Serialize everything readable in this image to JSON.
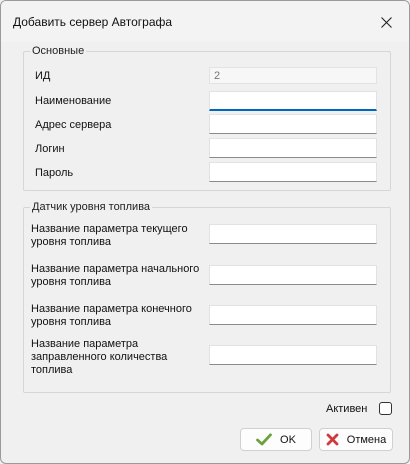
{
  "window": {
    "title": "Добавить сервер Автографа"
  },
  "main_group": {
    "legend": "Основные",
    "fields": [
      {
        "label": "ИД",
        "value": "2"
      },
      {
        "label": "Наименование",
        "value": ""
      },
      {
        "label": "Адрес сервера",
        "value": ""
      },
      {
        "label": "Логин",
        "value": ""
      },
      {
        "label": "Пароль",
        "value": ""
      }
    ]
  },
  "fuel_group": {
    "legend": "Датчик уровня топлива",
    "fields": [
      {
        "label": "Название параметра текущего уровня топлива",
        "value": ""
      },
      {
        "label": "Название параметра начального уровня топлива",
        "value": ""
      },
      {
        "label": "Название параметра конечного уровня топлива",
        "value": ""
      },
      {
        "label": "Название параметра заправленного количества топлива",
        "value": ""
      }
    ]
  },
  "active": {
    "label": "Активен",
    "checked": false
  },
  "buttons": {
    "ok_label": "OK",
    "cancel_label": "Отмена"
  },
  "colors": {
    "accent": "#0067c0",
    "ok_check": "#6aa33c",
    "cancel_x": "#d03a3a"
  }
}
